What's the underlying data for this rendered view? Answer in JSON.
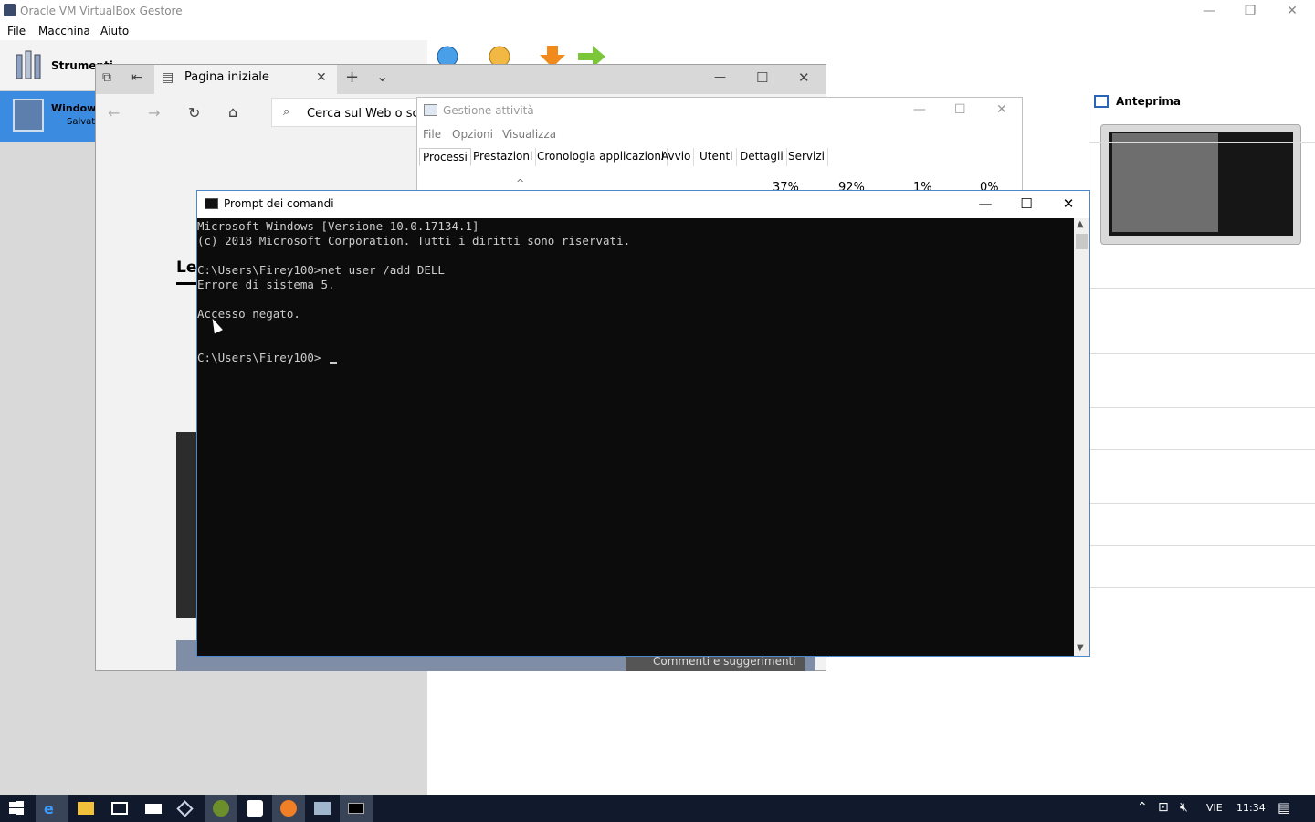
{
  "virtualbox": {
    "title": "Oracle VM VirtualBox Gestore",
    "menu": [
      "File",
      "Macchina",
      "Aiuto"
    ],
    "tools_label": "Strumenti",
    "vm_name": "Windows",
    "vm_state": "Salvat",
    "preview_label": "Anteprima",
    "controls": {
      "minimize": "—",
      "restore": "❐",
      "close": "✕"
    }
  },
  "edge": {
    "tab_label": "Pagina iniziale",
    "search_placeholder": "Cerca sul Web o scriv",
    "content_heading": "Le",
    "feedback": "Commenti e suggerimenti",
    "new_tab": "+",
    "tab_dropdown": "⌄",
    "controls": {
      "minimize": "—",
      "maximize": "☐",
      "close": "✕"
    }
  },
  "task_manager": {
    "title": "Gestione attività",
    "menu": [
      "File",
      "Opzioni",
      "Visualizza"
    ],
    "tabs": [
      "Processi",
      "Prestazioni",
      "Cronologia applicazioni",
      "Avvio",
      "Utenti",
      "Dettagli",
      "Servizi"
    ],
    "percentages": [
      "37%",
      "92%",
      "1%",
      "0%"
    ]
  },
  "cmd": {
    "title": "Prompt dei comandi",
    "lines": [
      "Microsoft Windows [Versione 10.0.17134.1]",
      "(c) 2018 Microsoft Corporation. Tutti i diritti sono riservati.",
      "",
      "C:\\Users\\Firey100>net user /add DELL",
      "Errore di sistema 5.",
      "",
      "Accesso negato.",
      "",
      "",
      "C:\\Users\\Firey100>"
    ],
    "controls": {
      "minimize": "—",
      "maximize": "☐",
      "close": "✕"
    }
  },
  "taskbar": {
    "language": "VIE",
    "time": "11:34"
  }
}
